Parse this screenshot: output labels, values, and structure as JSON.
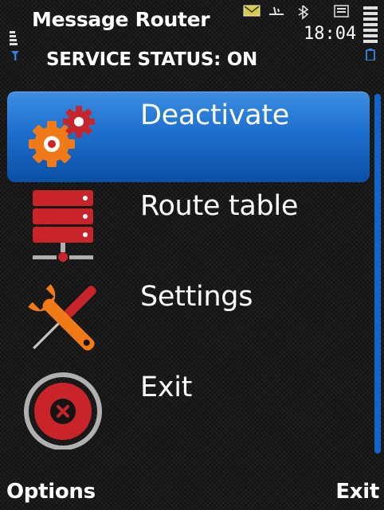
{
  "header": {
    "title": "Message Router",
    "service_status": "SERVICE STATUS: ON",
    "clock": "18:04",
    "status_icons": [
      "signal-strength-icon",
      "mail-icon",
      "data-connection-icon",
      "bluetooth-icon",
      "keypad-icon",
      "battery-icon"
    ]
  },
  "menu": {
    "items": [
      {
        "label": "Deactivate",
        "icon": "gears-icon",
        "selected": true
      },
      {
        "label": "Route table",
        "icon": "server-rack-icon",
        "selected": false
      },
      {
        "label": "Settings",
        "icon": "tools-icon",
        "selected": false
      },
      {
        "label": "Exit",
        "icon": "close-circle-icon",
        "selected": false
      }
    ]
  },
  "softkeys": {
    "left": "Options",
    "right": "Exit"
  },
  "colors": {
    "selection": "#1d6fcd",
    "scrollbar": "#1464c8",
    "icon_red": "#c8242a",
    "icon_orange": "#f07a18"
  }
}
